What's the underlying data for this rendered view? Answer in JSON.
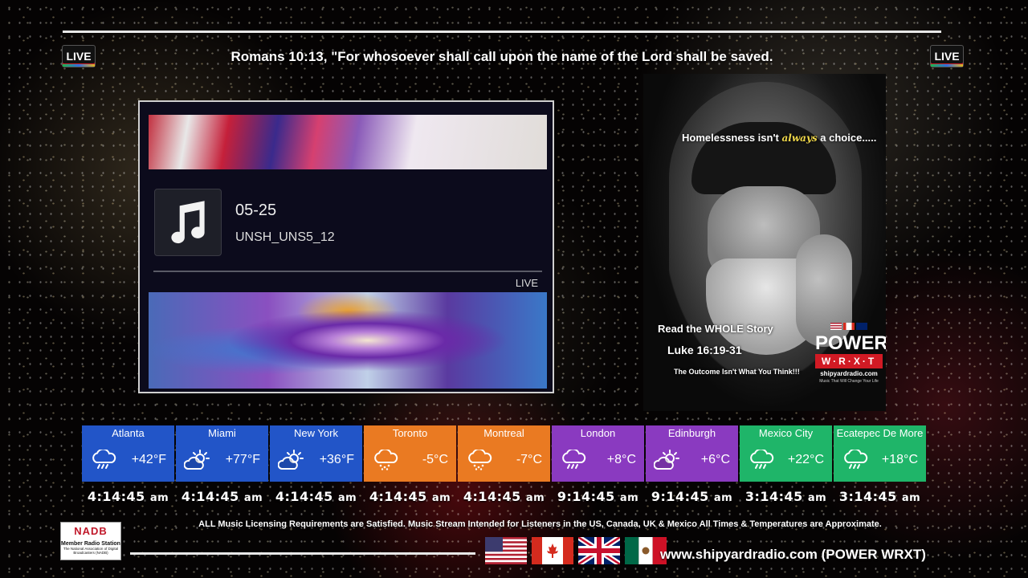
{
  "header": {
    "live_left": "LIVE",
    "live_right": "LIVE",
    "verse": "Romans 10:13, \"For whosoever shall call upon the name of the Lord shall be saved."
  },
  "player": {
    "track_title": "05-25",
    "track_subtitle": "UNSH_UNS5_12",
    "live_label": "LIVE",
    "icon": "music-note-icon"
  },
  "poster": {
    "headline_start": "Homelessness isn't",
    "headline_always": "always",
    "headline_end": "a choice.....",
    "cta": "Read the WHOLE Story",
    "reference": "Luke 16:19-31",
    "outcome": "The Outcome Isn't What You Think!!!",
    "brand": "POWER",
    "brand_sub": "W·R·X·T",
    "site": "shipyardradio.com",
    "tagline": "Music That Will Change Your Life"
  },
  "weather": [
    {
      "city": "Atlanta",
      "temp": "+42°F",
      "icon": "rain-cloud-icon",
      "color": "#2255c8",
      "time": "4:14:45",
      "ampm": "am"
    },
    {
      "city": "Miami",
      "temp": "+77°F",
      "icon": "partly-cloudy-icon",
      "color": "#2255c8",
      "time": "4:14:45",
      "ampm": "am"
    },
    {
      "city": "New York",
      "temp": "+36°F",
      "icon": "partly-cloudy-icon",
      "color": "#2255c8",
      "time": "4:14:45",
      "ampm": "am"
    },
    {
      "city": "Toronto",
      "temp": "-5°C",
      "icon": "snow-cloud-icon",
      "color": "#ea7a22",
      "time": "4:14:45",
      "ampm": "am"
    },
    {
      "city": "Montreal",
      "temp": "-7°C",
      "icon": "snow-cloud-icon",
      "color": "#ea7a22",
      "time": "4:14:45",
      "ampm": "am"
    },
    {
      "city": "London",
      "temp": "+8°C",
      "icon": "rain-cloud-icon",
      "color": "#8a3ac0",
      "time": "9:14:45",
      "ampm": "am"
    },
    {
      "city": "Edinburgh",
      "temp": "+6°C",
      "icon": "partly-cloudy-icon",
      "color": "#8a3ac0",
      "time": "9:14:45",
      "ampm": "am"
    },
    {
      "city": "Mexico City",
      "temp": "+22°C",
      "icon": "rain-cloud-icon",
      "color": "#1fb569",
      "time": "3:14:45",
      "ampm": "am"
    },
    {
      "city": "Ecatepec De More",
      "temp": "+18°C",
      "icon": "rain-cloud-icon",
      "color": "#1fb569",
      "time": "3:14:45",
      "ampm": "am"
    }
  ],
  "footer": {
    "licensing": "ALL Music Licensing Requirements are Satisfied.  Music Stream Intended for Listeners in the US, Canada, UK & Mexico  All Times & Temperatures are Approximate.",
    "nadb_logo": "NADB",
    "nadb_line1": "Member Radio Station",
    "nadb_line2": "The National Association of Digital Broadcasters (NADB)",
    "site": "www.shipyardradio.com (POWER WRXT)",
    "flags": [
      "us-flag-icon",
      "canada-flag-icon",
      "uk-flag-icon",
      "mexico-flag-icon"
    ]
  }
}
